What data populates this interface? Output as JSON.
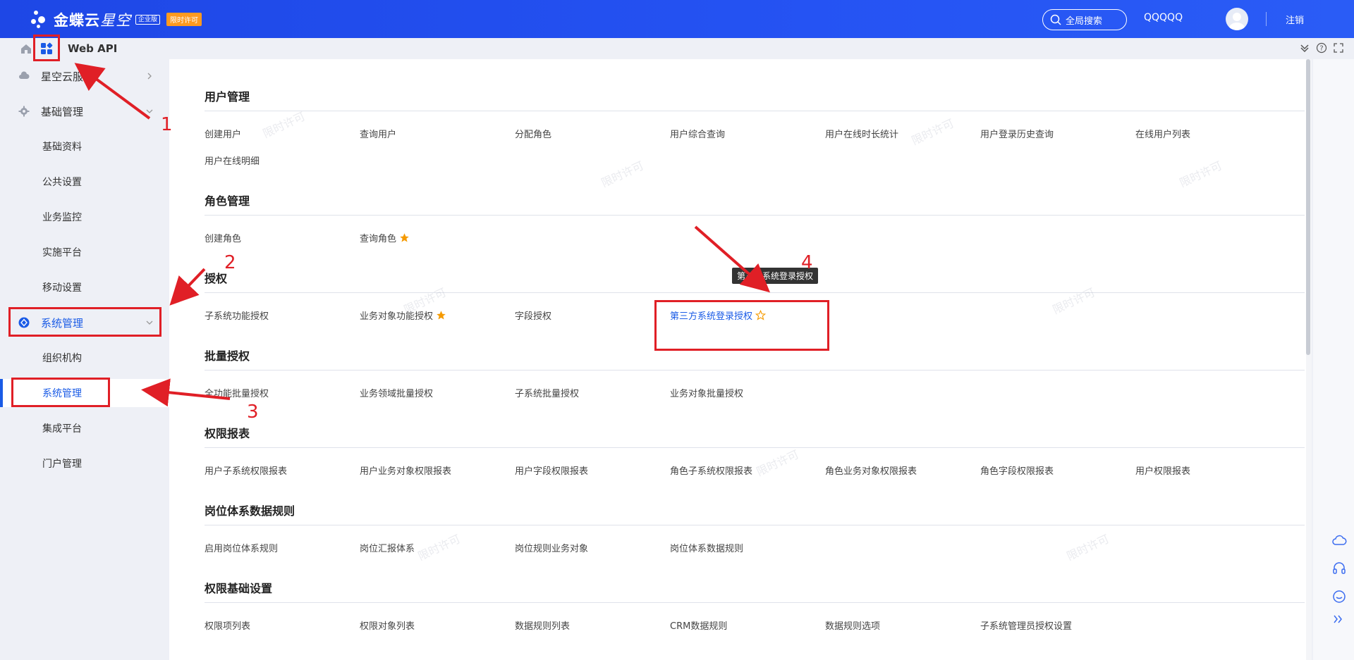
{
  "header": {
    "logo_text_bold": "金蝶云",
    "logo_text_light": "星空",
    "edition_badge": "企业版",
    "license_badge": "限时许可",
    "search_label": "全局搜索",
    "username": "QQQQQ",
    "logout_label": "注销"
  },
  "breadcrumb": {
    "title": "Web API"
  },
  "sidebar": {
    "items": [
      {
        "label": "星空云服务"
      },
      {
        "label": "基础管理"
      },
      {
        "label": "基础资料"
      },
      {
        "label": "公共设置"
      },
      {
        "label": "业务监控"
      },
      {
        "label": "实施平台"
      },
      {
        "label": "移动设置"
      },
      {
        "label": "系统管理"
      },
      {
        "label": "组织机构"
      },
      {
        "label": "系统管理"
      },
      {
        "label": "集成平台"
      },
      {
        "label": "门户管理"
      }
    ]
  },
  "sections": [
    {
      "title": "用户管理",
      "links": [
        "创建用户",
        "查询用户",
        "分配角色",
        "用户综合查询",
        "用户在线时长统计",
        "用户登录历史查询",
        "在线用户列表",
        "用户在线明细"
      ]
    },
    {
      "title": "角色管理",
      "links": [
        "创建角色",
        "查询角色"
      ]
    },
    {
      "title": "授权",
      "links": [
        "子系统功能授权",
        "业务对象功能授权",
        "字段授权",
        "第三方系统登录授权"
      ]
    },
    {
      "title": "批量授权",
      "links": [
        "全功能批量授权",
        "业务领域批量授权",
        "子系统批量授权",
        "业务对象批量授权"
      ]
    },
    {
      "title": "权限报表",
      "links": [
        "用户子系统权限报表",
        "用户业务对象权限报表",
        "用户字段权限报表",
        "角色子系统权限报表",
        "角色业务对象权限报表",
        "角色字段权限报表",
        "用户权限报表"
      ]
    },
    {
      "title": "岗位体系数据规则",
      "links": [
        "启用岗位体系规则",
        "岗位汇报体系",
        "岗位规则业务对象",
        "岗位体系数据规则"
      ]
    },
    {
      "title": "权限基础设置",
      "links": [
        "权限项列表",
        "权限对象列表",
        "数据规则列表",
        "CRM数据规则",
        "数据规则选项",
        "子系统管理员授权设置"
      ]
    }
  ],
  "tooltip": "第三方系统登录授权",
  "watermark_text": "限时许可",
  "annotations": [
    "1",
    "2",
    "3",
    "4"
  ],
  "colors": {
    "brand": "#2553f3",
    "link_active": "#1a5be6",
    "star": "#f59a00",
    "annotation": "#e01f26",
    "badge": "#ff9a1f"
  }
}
